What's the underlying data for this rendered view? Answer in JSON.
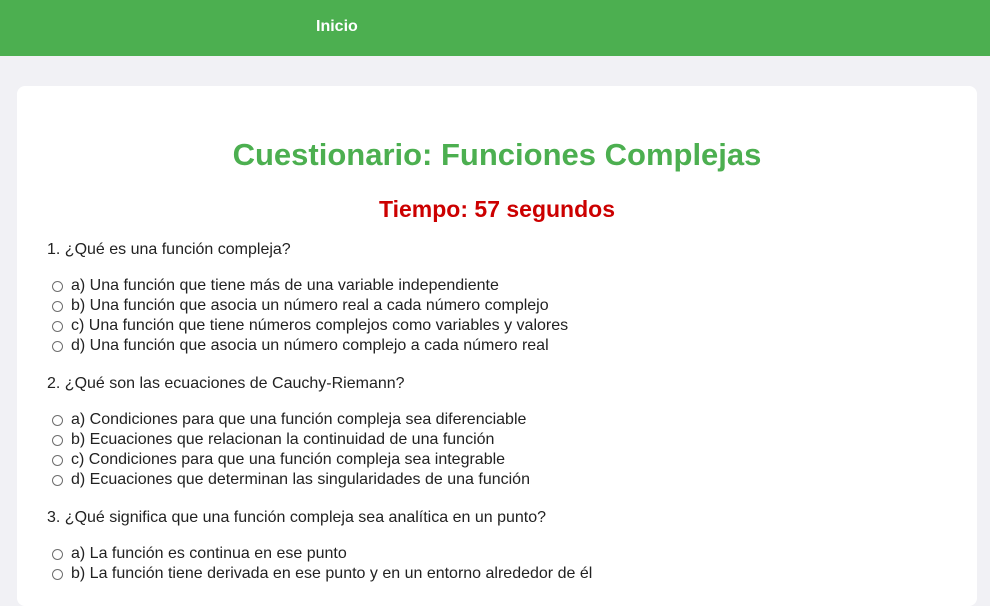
{
  "nav": {
    "home_label": "Inicio"
  },
  "quiz": {
    "title": "Cuestionario: Funciones Complejas",
    "timer_label": "Tiempo: 57 segundos",
    "questions": [
      {
        "text": "1. ¿Qué es una función compleja?",
        "options": [
          "a) Una función que tiene más de una variable independiente",
          "b) Una función que asocia un número real a cada número complejo",
          "c) Una función que tiene números complejos como variables y valores",
          "d) Una función que asocia un número complejo a cada número real"
        ]
      },
      {
        "text": "2. ¿Qué son las ecuaciones de Cauchy-Riemann?",
        "options": [
          "a) Condiciones para que una función compleja sea diferenciable",
          "b) Ecuaciones que relacionan la continuidad de una función",
          "c) Condiciones para que una función compleja sea integrable",
          "d) Ecuaciones que determinan las singularidades de una función"
        ]
      },
      {
        "text": "3. ¿Qué significa que una función compleja sea analítica en un punto?",
        "options": [
          "a) La función es continua en ese punto",
          "b) La función tiene derivada en ese punto y en un entorno alrededor de él"
        ]
      }
    ]
  },
  "colors": {
    "header_bg": "#4caf50",
    "title": "#4caf50",
    "timer": "#cc0000",
    "page_bg": "#f1f1f5"
  }
}
